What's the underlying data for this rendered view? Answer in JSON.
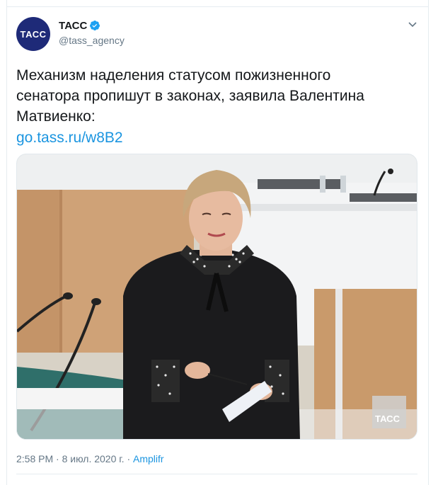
{
  "account": {
    "avatar_text": "ТАСС",
    "name": "ТАСС",
    "handle": "@tass_agency",
    "verified": true
  },
  "tweet": {
    "text": "Механизм наделения статусом пожизненного\nсенатора пропишут в законах, заявила Валентина\nМатвиенко:",
    "link": "go.tass.ru/w8B2"
  },
  "photo": {
    "watermark": "ТАСС"
  },
  "meta": {
    "time": "2:58 PM",
    "date": "8 июл. 2020 г.",
    "separator": "·",
    "source": "Amplifr"
  },
  "colors": {
    "brand": "#1e2a78",
    "link": "#1b95e0",
    "muted": "#657786"
  }
}
